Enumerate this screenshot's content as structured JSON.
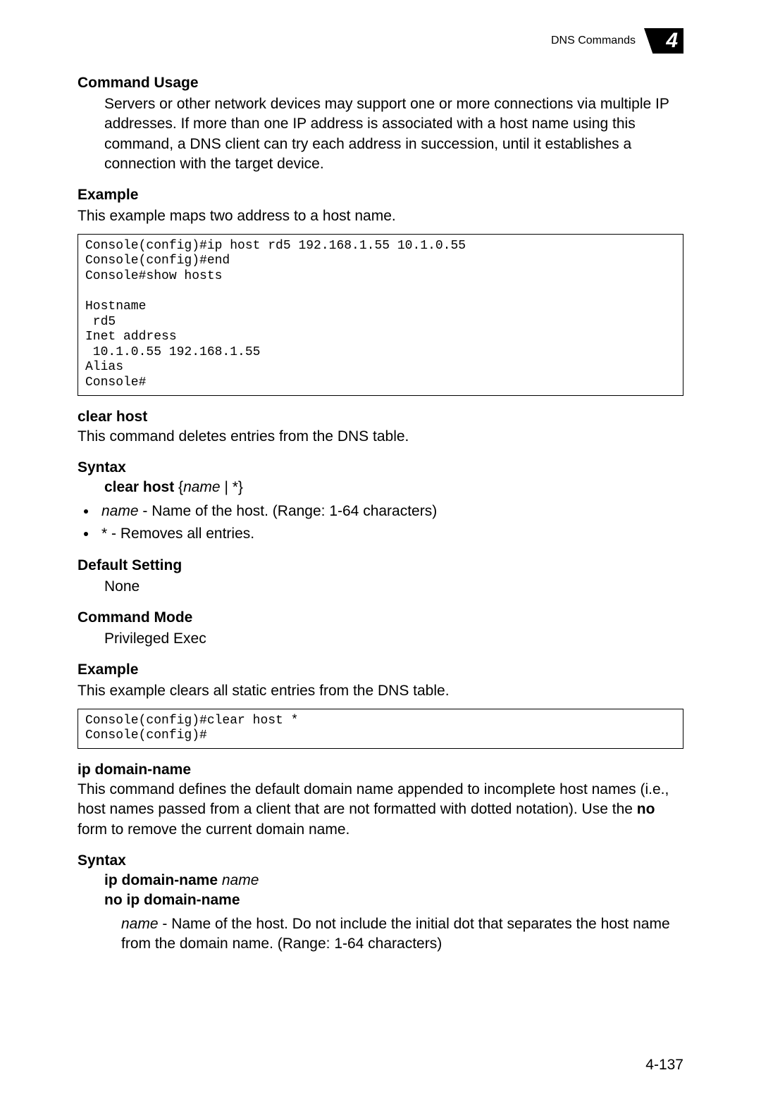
{
  "header": {
    "title": "DNS Commands",
    "chapter": "4"
  },
  "sections": {
    "command_usage": {
      "heading": "Command Usage",
      "body": "Servers or other network devices may support one or more connections via multiple IP addresses. If more than one IP address is associated with a host name using this command, a DNS client can try each address in succession, until it establishes a connection with the target device."
    },
    "example1": {
      "heading": "Example",
      "intro": "This example maps two address to a host name.",
      "code": "Console(config)#ip host rd5 192.168.1.55 10.1.0.55\nConsole(config)#end\nConsole#show hosts\n\nHostname\n rd5\nInet address\n 10.1.0.55 192.168.1.55\nAlias\nConsole#"
    },
    "clear_host": {
      "title": "clear host",
      "desc": "This command deletes entries from the DNS table.",
      "syntax_heading": "Syntax",
      "syntax_cmd": "clear host",
      "syntax_args_open": " {",
      "syntax_args_name": "name",
      "syntax_args_rest": " | *}",
      "bullets": [
        {
          "term": "name",
          "desc": " - Name of the host. (Range: 1-64 characters)"
        },
        {
          "term": "*",
          "desc": " - Removes all entries."
        }
      ],
      "default_heading": "Default Setting",
      "default_value": "None",
      "mode_heading": "Command Mode",
      "mode_value": "Privileged Exec",
      "example_heading": "Example",
      "example_intro": "This example clears all static entries from the DNS table.",
      "example_code": "Console(config)#clear host *\nConsole(config)#"
    },
    "ip_domain_name": {
      "title": "ip domain-name",
      "desc_pre": "This command defines the default domain name appended to incomplete host names (i.e., host names passed from a client that are not formatted with dotted notation). Use the ",
      "desc_bold": "no",
      "desc_post": " form to remove the current domain name.",
      "syntax_heading": "Syntax",
      "syntax_cmd1_bold": "ip domain-name",
      "syntax_cmd1_ital": " name",
      "syntax_cmd2": "no ip domain-name",
      "param_term": "name",
      "param_desc": " - Name of the host. Do not include the initial dot that separates the host name from the domain name. (Range: 1-64 characters)"
    }
  },
  "page_number": "4-137"
}
